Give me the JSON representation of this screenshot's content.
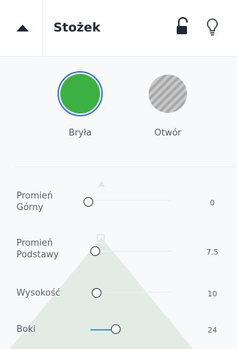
{
  "header": {
    "title": "Stożek",
    "icons": {
      "collapse": "caret-up-icon",
      "lock": "unlocked-padlock-icon",
      "hint": "lightbulb-icon"
    }
  },
  "modes": [
    {
      "label": "Bryła",
      "selected": true,
      "color": "#3cb043"
    },
    {
      "label": "Otwór",
      "selected": false,
      "color": "#b3b3b3"
    }
  ],
  "sliders": [
    {
      "label_line1": "Promień",
      "label_line2": "Górny",
      "value": "0"
    },
    {
      "label_line1": "Promień",
      "label_line2": "Podstawy",
      "value": "7.5"
    },
    {
      "label_line1": "Wysokość",
      "label_line2": "",
      "value": "10"
    },
    {
      "label_line1": "Boki",
      "label_line2": "",
      "value": "24"
    }
  ],
  "colors": {
    "accent": "#4a8fe0",
    "selected_ring": "#2f6fe0",
    "text": "#3a4a5a"
  }
}
